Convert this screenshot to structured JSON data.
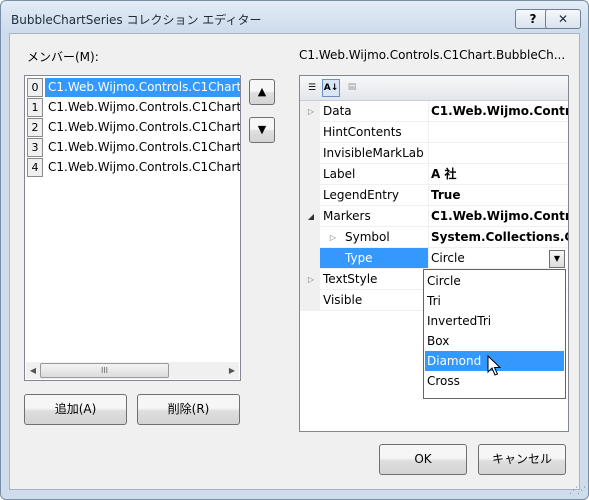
{
  "window": {
    "title": "BubbleChartSeries コレクション エディター",
    "help_label": "?",
    "close_label": "✕"
  },
  "members": {
    "label": "メンバー(M):",
    "items": [
      {
        "index": "0",
        "text": "C1.Web.Wijmo.Controls.C1Chart.",
        "selected": true
      },
      {
        "index": "1",
        "text": "C1.Web.Wijmo.Controls.C1Chart."
      },
      {
        "index": "2",
        "text": "C1.Web.Wijmo.Controls.C1Chart."
      },
      {
        "index": "3",
        "text": "C1.Web.Wijmo.Controls.C1Chart."
      },
      {
        "index": "4",
        "text": "C1.Web.Wijmo.Controls.C1Chart."
      }
    ],
    "scroll_thumb": "III",
    "add_button": "追加(A)",
    "remove_button": "削除(R)"
  },
  "properties": {
    "label": "C1.Web.Wijmo.Controls.C1Chart.BubbleCh...",
    "rows": [
      {
        "name": "Data",
        "value": "C1.Web.Wijmo.Contro",
        "bold": true,
        "expander": "collapsed"
      },
      {
        "name": "HintContents",
        "value": ""
      },
      {
        "name": "InvisibleMarkLab",
        "value": ""
      },
      {
        "name": "Label",
        "value": "A 社",
        "bold": true
      },
      {
        "name": "LegendEntry",
        "value": "True",
        "bold": true
      },
      {
        "name": "Markers",
        "value": "C1.Web.Wijmo.Contro",
        "bold": true,
        "expander": "expanded"
      },
      {
        "name": "Symbol",
        "value": "System.Collections.Ge",
        "bold": true,
        "expander": "collapsed",
        "indent": true
      },
      {
        "name": "Type",
        "value": "Circle",
        "selected": true,
        "indent": true
      },
      {
        "name": "TextStyle",
        "value": "",
        "expander": "collapsed"
      },
      {
        "name": "Visible",
        "value": ""
      }
    ],
    "dropdown_options": [
      "Circle",
      "Tri",
      "InvertedTri",
      "Box",
      "Diamond",
      "Cross"
    ],
    "highlighted_option": "Diamond"
  },
  "footer": {
    "ok_button": "OK",
    "cancel_button": "キャンセル"
  },
  "colors": {
    "selection": "#3399ff",
    "titlebar": "#cfdcec"
  }
}
